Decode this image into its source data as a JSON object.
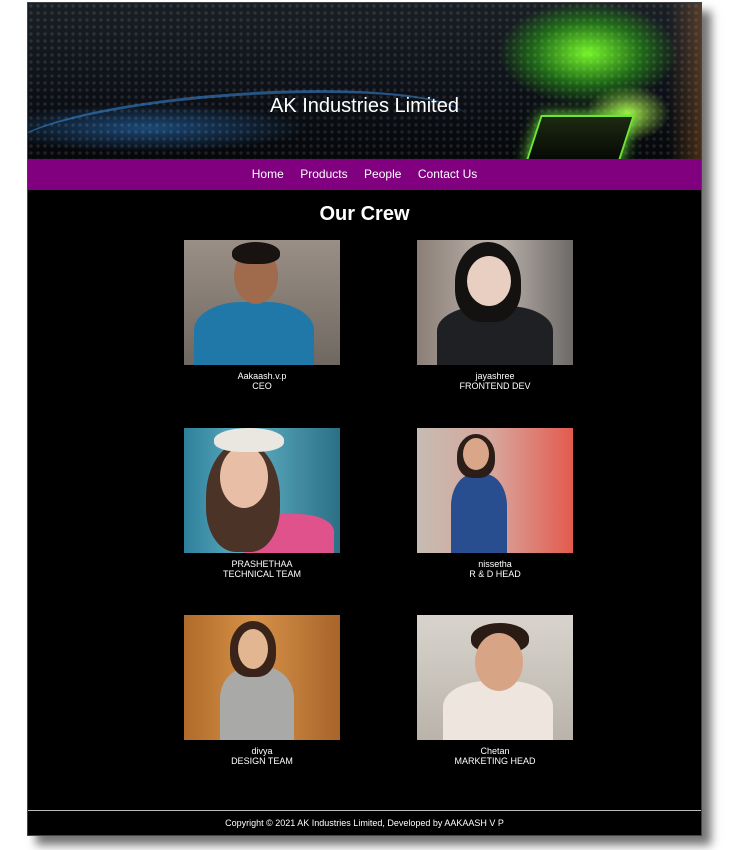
{
  "site": {
    "title": "AK Industries Limited"
  },
  "nav": {
    "items": [
      {
        "label": "Home"
      },
      {
        "label": "Products"
      },
      {
        "label": "People"
      },
      {
        "label": "Contact Us"
      }
    ]
  },
  "crew": {
    "heading": "Our Crew",
    "members": [
      {
        "name": "Aakaash.v.p",
        "role": "CEO"
      },
      {
        "name": "jayashree",
        "role": "FRONTEND DEV"
      },
      {
        "name": "PRASHETHAA",
        "role": "TECHNICAL TEAM"
      },
      {
        "name": "nissetha",
        "role": "R & D HEAD"
      },
      {
        "name": "divya",
        "role": "DESIGN TEAM"
      },
      {
        "name": "Chetan",
        "role": "MARKETING HEAD"
      }
    ]
  },
  "footer": {
    "text": "Copyright © 2021 AK Industries Limited, Developed by AAKAASH V P"
  },
  "colors": {
    "nav": "#800080",
    "page_bg": "#000000"
  }
}
